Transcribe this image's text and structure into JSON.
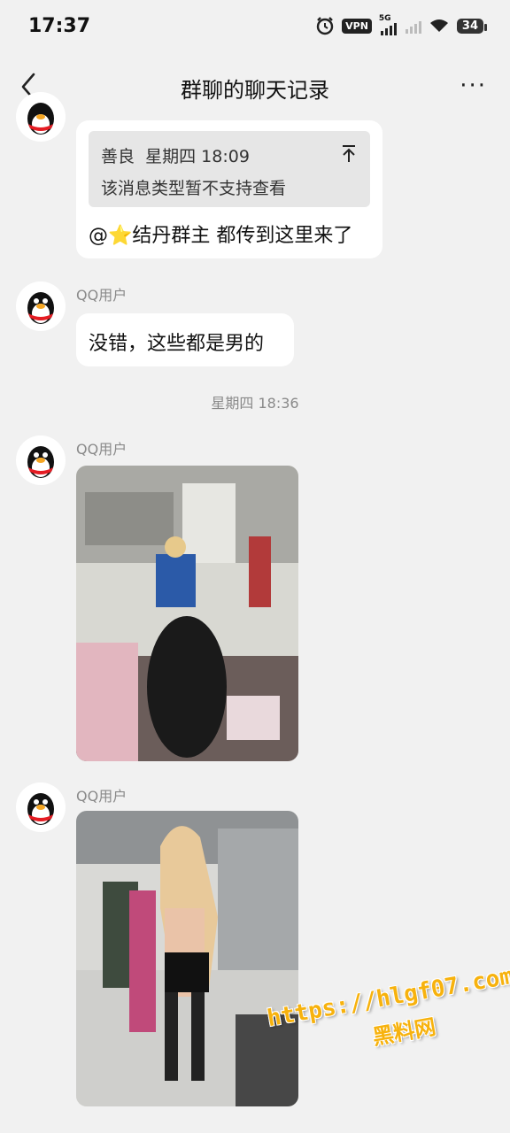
{
  "status_bar": {
    "time": "17:37",
    "vpn": "VPN",
    "network": "5G",
    "battery": "34"
  },
  "header": {
    "title": "群聊的聊天记录",
    "more": "···"
  },
  "messages": [
    {
      "quote": {
        "author": "善良",
        "time": "星期四 18:09",
        "text": "该消息类型暂不支持查看"
      },
      "text": "@⭐结丹群主 都传到这里来了"
    },
    {
      "sender": "QQ用户",
      "text": "没错，这些都是男的"
    },
    {
      "timestamp": "星期四 18:36"
    },
    {
      "sender": "QQ用户",
      "image_alt": "photo"
    },
    {
      "sender": "QQ用户",
      "image_alt": "photo"
    }
  ],
  "watermark": {
    "url": "https://hlgf07.com",
    "name": "黑料网"
  },
  "colors": {
    "background": "#f1f1f1",
    "bubble": "#ffffff",
    "quote_bg": "#e6e6e6",
    "watermark": "#f7b20d"
  }
}
